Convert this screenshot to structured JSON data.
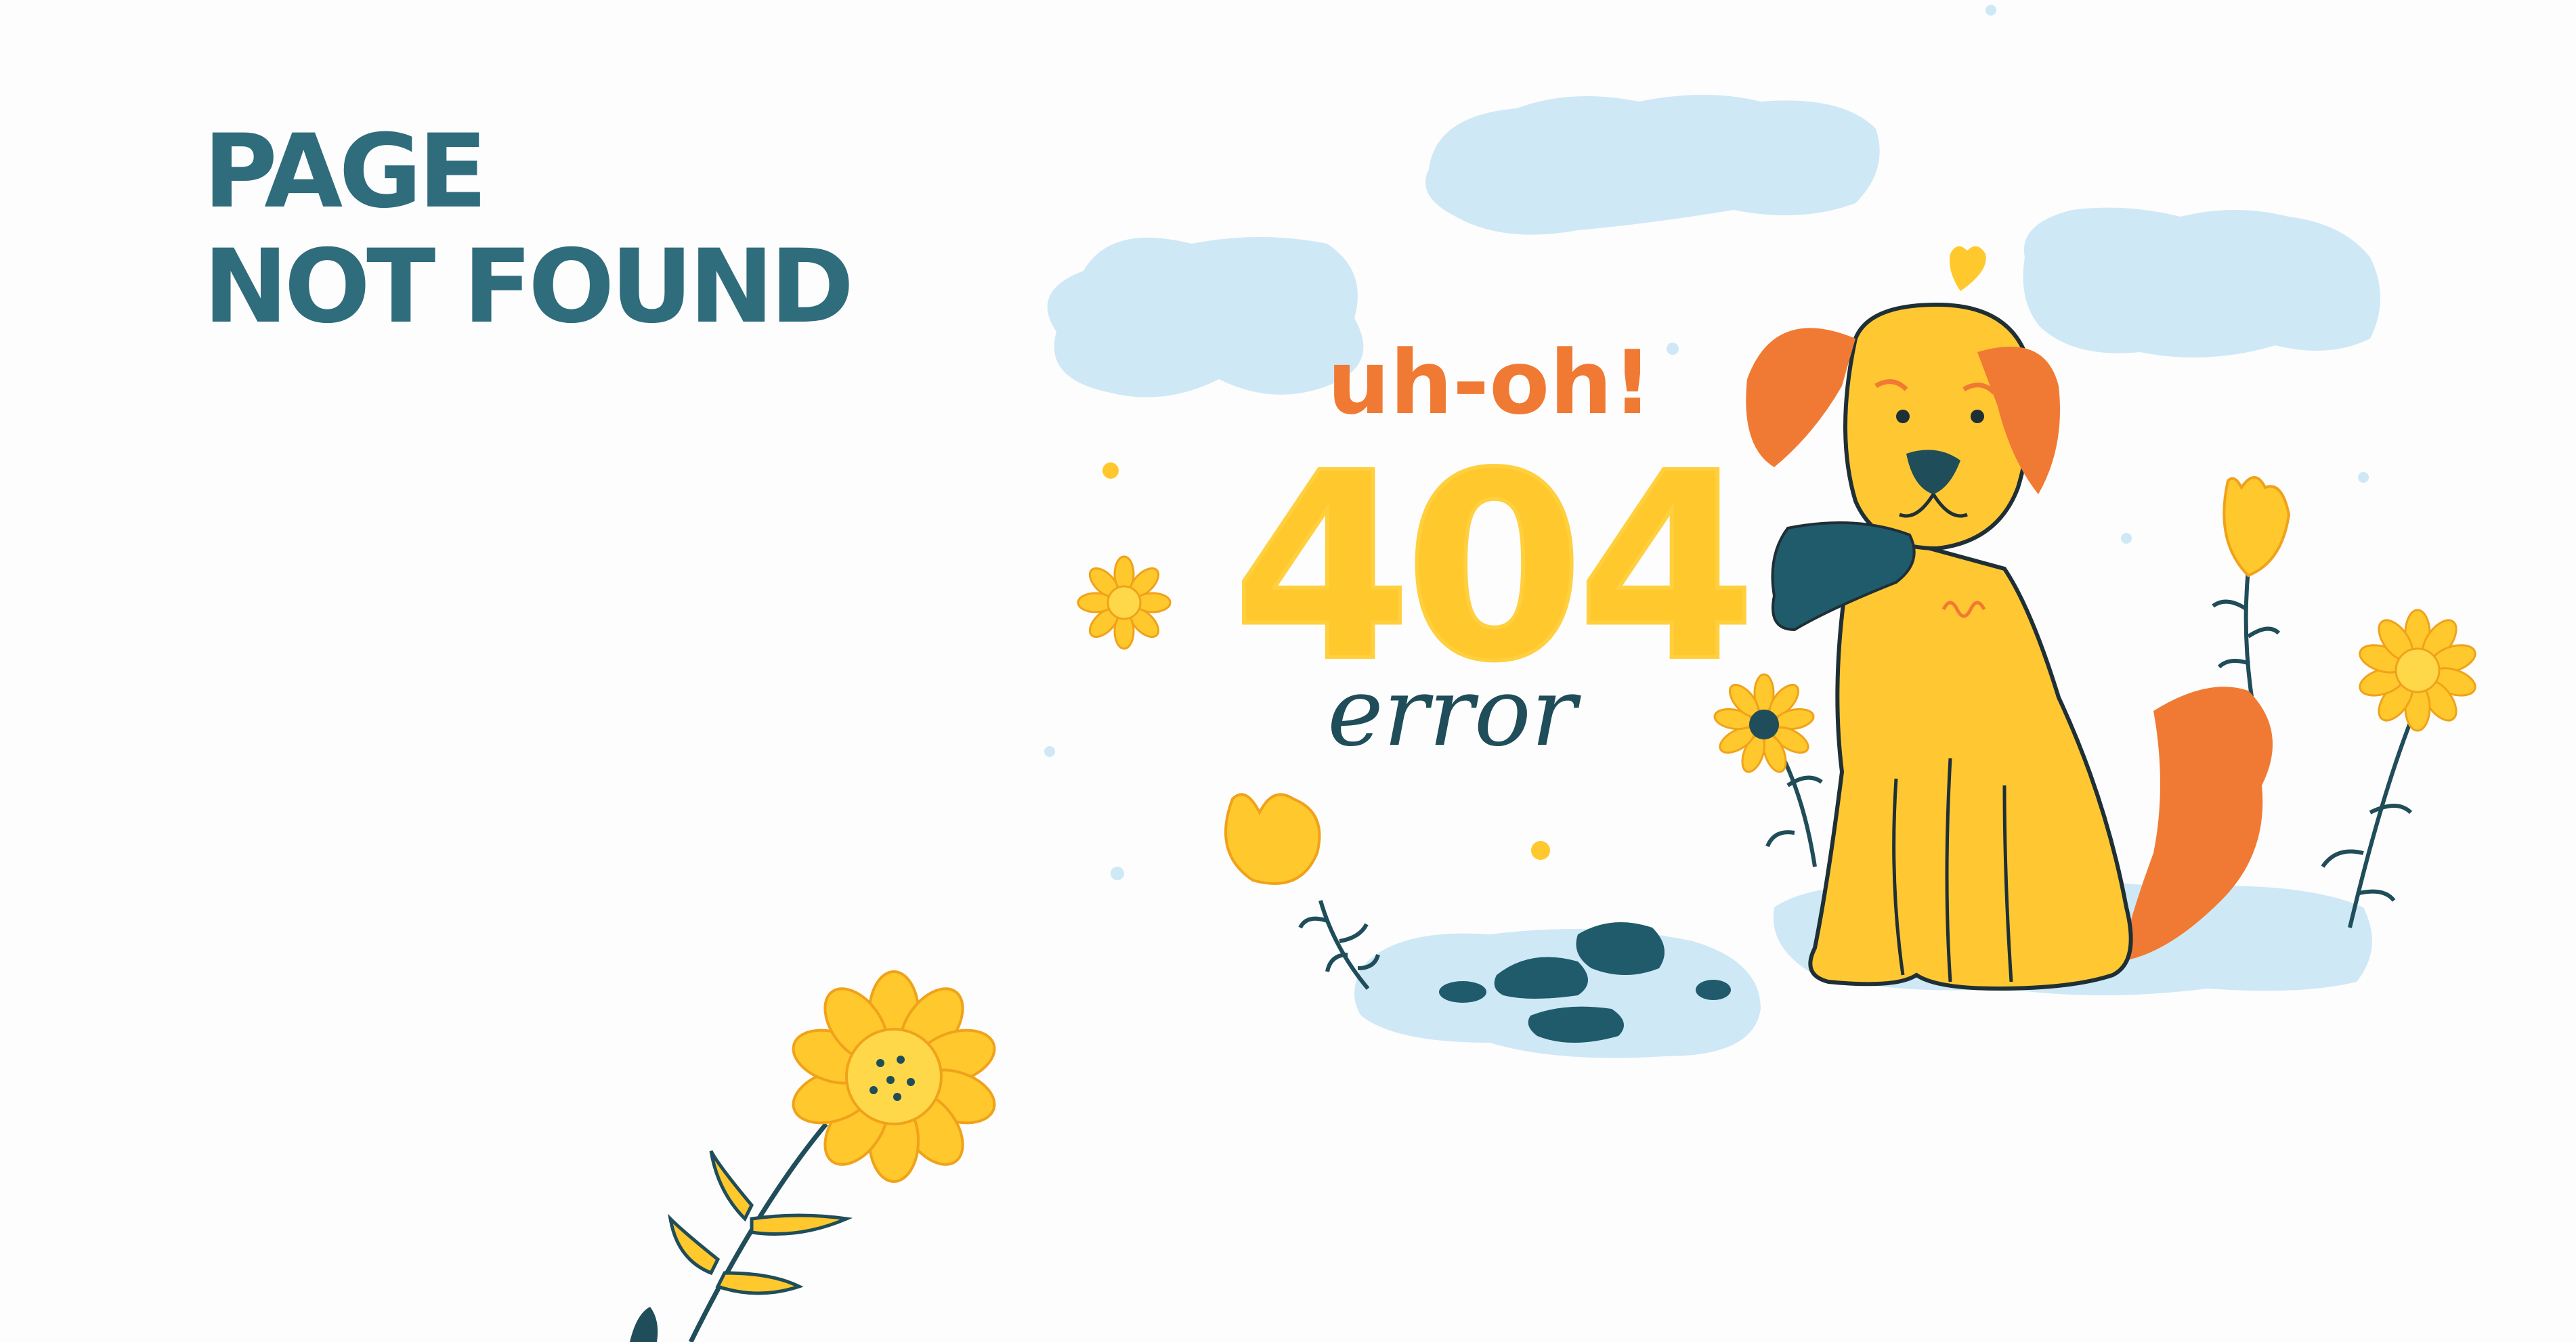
{
  "page": {
    "title_line1": "PAGE",
    "title_line2": "NOT FOUND"
  },
  "illustration": {
    "exclamation": "uh-oh!",
    "code": "404",
    "caption": "error",
    "subject": "dog holding a shoe",
    "icons": [
      "cloud-icon",
      "flower-icon",
      "heart-icon",
      "shoe-icon",
      "puddle-icon",
      "dog-icon"
    ]
  },
  "colors": {
    "title": "#2f6c7c",
    "exclamation": "#f07a33",
    "code": "#ffc82d",
    "caption": "#1f4d59",
    "cloud": "#cfe8f6",
    "dog": "#ffc833",
    "dog_ear": "#f07a33",
    "shoe": "#1f5b6b"
  }
}
